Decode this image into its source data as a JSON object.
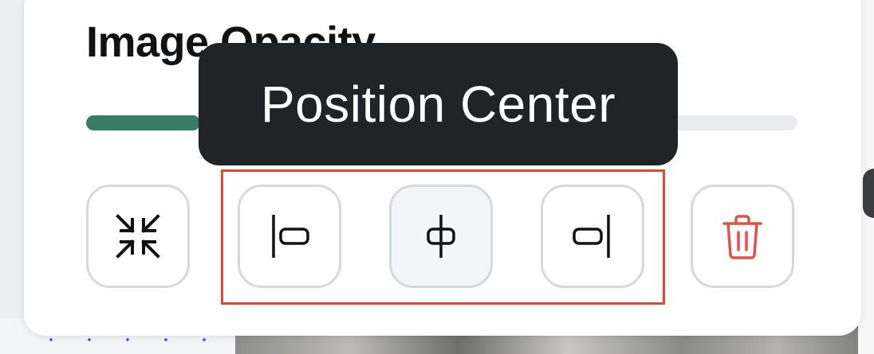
{
  "panel": {
    "title": "Image Opacity"
  },
  "opacity_slider": {
    "value_fraction": 0.16,
    "fill_color": "#3a7d66",
    "track_color": "#e9ebee"
  },
  "tooltip": {
    "text": "Position Center"
  },
  "toolbar": {
    "buttons": [
      {
        "name": "collapse",
        "icon": "collapse-arrows-icon"
      },
      {
        "name": "position-left",
        "icon": "align-left-icon"
      },
      {
        "name": "position-center",
        "icon": "align-center-icon",
        "active": true
      },
      {
        "name": "position-right",
        "icon": "align-right-icon"
      },
      {
        "name": "delete",
        "icon": "trash-icon",
        "color": "#e0524a"
      }
    ],
    "highlight_color": "#e1472c"
  }
}
